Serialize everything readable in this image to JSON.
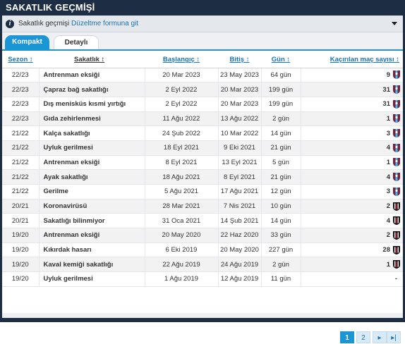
{
  "header": {
    "title": "SAKATLIK GEÇMİŞİ"
  },
  "infobar": {
    "prefix": "Sakatlık geçmişi ",
    "link": "Düzeltme formuna git"
  },
  "tabs": [
    {
      "label": "Kompakt"
    },
    {
      "label": "Detaylı"
    }
  ],
  "table": {
    "headers": {
      "season": "Sezon ↕",
      "injury": "Sakatlık ↕",
      "from": "Başlangıç ↕",
      "until": "Bitiş ↕",
      "days": "Gün ↕",
      "games": "Kaçırılan maç sayısı ↕"
    },
    "rows": [
      {
        "season": "22/23",
        "injury": "Antrenman eksiği",
        "from": "20 Mar 2023",
        "until": "23 May 2023",
        "days": "64 gün",
        "games": "9",
        "club": "trabzonspor"
      },
      {
        "season": "22/23",
        "injury": "Çapraz bağ sakatlığı",
        "from": "2 Eyl 2022",
        "until": "20 Mar 2023",
        "days": "199 gün",
        "games": "31",
        "club": "trabzonspor"
      },
      {
        "season": "22/23",
        "injury": "Dış menisküs kısmi yırtığı",
        "from": "2 Eyl 2022",
        "until": "20 Mar 2023",
        "days": "199 gün",
        "games": "31",
        "club": "trabzonspor"
      },
      {
        "season": "22/23",
        "injury": "Gıda zehirlenmesi",
        "from": "11 Ağu 2022",
        "until": "13 Ağu 2022",
        "days": "2 gün",
        "games": "1",
        "club": "trabzonspor"
      },
      {
        "season": "21/22",
        "injury": "Kalça sakatlığı",
        "from": "24 Şub 2022",
        "until": "10 Mar 2022",
        "days": "14 gün",
        "games": "3",
        "club": "trabzonspor"
      },
      {
        "season": "21/22",
        "injury": "Uyluk gerilmesi",
        "from": "18 Eyl 2021",
        "until": "9 Eki 2021",
        "days": "21 gün",
        "games": "4",
        "club": "trabzonspor"
      },
      {
        "season": "21/22",
        "injury": "Antrenman eksiği",
        "from": "8 Eyl 2021",
        "until": "13 Eyl 2021",
        "days": "5 gün",
        "games": "1",
        "club": "trabzonspor"
      },
      {
        "season": "21/22",
        "injury": "Ayak sakatlığı",
        "from": "18 Ağu 2021",
        "until": "8 Eyl 2021",
        "days": "21 gün",
        "games": "4",
        "club": "trabzonspor"
      },
      {
        "season": "21/22",
        "injury": "Gerilme",
        "from": "5 Ağu 2021",
        "until": "17 Ağu 2021",
        "days": "12 gün",
        "games": "3",
        "club": "trabzonspor"
      },
      {
        "season": "20/21",
        "injury": "Koronavirüsü",
        "from": "28 Mar 2021",
        "until": "7 Nis 2021",
        "days": "10 gün",
        "games": "2",
        "club": "besiktas"
      },
      {
        "season": "20/21",
        "injury": "Sakatlığı bilinmiyor",
        "from": "31 Oca 2021",
        "until": "14 Şub 2021",
        "days": "14 gün",
        "games": "4",
        "club": "besiktas"
      },
      {
        "season": "19/20",
        "injury": "Antrenman eksiği",
        "from": "20 May 2020",
        "until": "22 Haz 2020",
        "days": "33 gün",
        "games": "2",
        "club": "besiktas"
      },
      {
        "season": "19/20",
        "injury": "Kıkırdak hasarı",
        "from": "6 Eki 2019",
        "until": "20 May 2020",
        "days": "227 gün",
        "games": "28",
        "club": "besiktas"
      },
      {
        "season": "19/20",
        "injury": "Kaval kemiği sakatlığı",
        "from": "22 Ağu 2019",
        "until": "24 Ağu 2019",
        "days": "2 gün",
        "games": "1",
        "club": "besiktas"
      },
      {
        "season": "19/20",
        "injury": "Uyluk gerilmesi",
        "from": "1 Ağu 2019",
        "until": "12 Ağu 2019",
        "days": "11 gün",
        "games": "-",
        "club": ""
      }
    ]
  },
  "pagination": {
    "pages": [
      "1",
      "2"
    ],
    "current": "1",
    "next": "▸",
    "last": "▸|"
  },
  "colors": {
    "navy": "#1d2d44",
    "accent": "#1a95d5",
    "link": "#1a73b8",
    "trabzon_claret": "#7a1f3d",
    "trabzon_blue": "#4fb3e8",
    "besiktas_black": "#111111"
  },
  "icons": {
    "info": "info-icon",
    "caret": "chevron-down-icon",
    "club": "club-crest-icon"
  }
}
